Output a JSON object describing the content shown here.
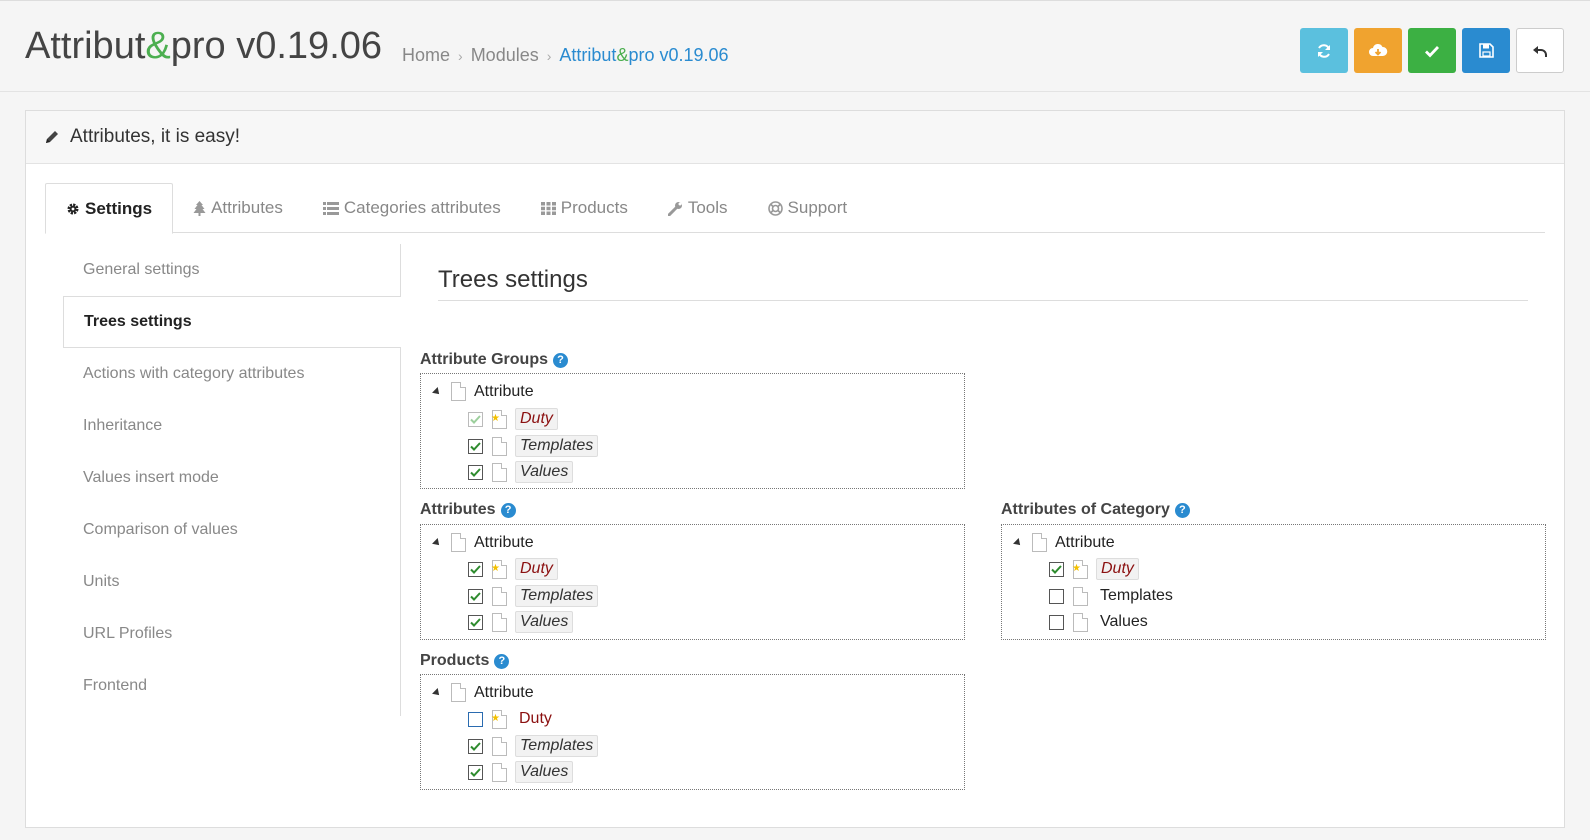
{
  "header": {
    "title_prefix": "Attribut",
    "title_amp": "&",
    "title_suffix": "pro v0.19.06",
    "breadcrumb": {
      "home": "Home",
      "modules": "Modules",
      "current_prefix": "Attribut",
      "current_amp": "&",
      "current_suffix": "pro v0.19.06"
    }
  },
  "toolbar": [
    {
      "icon": "refresh-icon"
    },
    {
      "icon": "cloud-download-icon"
    },
    {
      "icon": "check-icon"
    },
    {
      "icon": "floppy-save-icon"
    },
    {
      "icon": "undo-icon"
    }
  ],
  "panel": {
    "heading": "Attributes, it is easy!"
  },
  "tabs": [
    {
      "label": "Settings",
      "icon": "gear-icon",
      "active": true
    },
    {
      "label": "Attributes",
      "icon": "tree-icon"
    },
    {
      "label": "Categories attributes",
      "icon": "list-icon"
    },
    {
      "label": "Products",
      "icon": "grid-icon"
    },
    {
      "label": "Tools",
      "icon": "wrench-icon"
    },
    {
      "label": "Support",
      "icon": "lifebuoy-icon"
    }
  ],
  "sidenav": [
    {
      "label": "General settings"
    },
    {
      "label": "Trees settings",
      "active": true
    },
    {
      "label": "Actions with category attributes"
    },
    {
      "label": "Inheritance"
    },
    {
      "label": "Values insert mode"
    },
    {
      "label": "Comparison of values"
    },
    {
      "label": "Units"
    },
    {
      "label": "URL Profiles"
    },
    {
      "label": "Frontend"
    }
  ],
  "section_title": "Trees settings",
  "trees": {
    "attribute_groups": {
      "label": "Attribute Groups",
      "root": "Attribute",
      "items": [
        {
          "label": "Duty",
          "checked": true,
          "disabled": true
        },
        {
          "label": "Templates",
          "checked": true
        },
        {
          "label": "Values",
          "checked": true
        }
      ]
    },
    "attributes": {
      "label": "Attributes",
      "root": "Attribute",
      "items": [
        {
          "label": "Duty",
          "checked": true
        },
        {
          "label": "Templates",
          "checked": true
        },
        {
          "label": "Values",
          "checked": true
        }
      ]
    },
    "attributes_of_category": {
      "label": "Attributes of Category",
      "root": "Attribute",
      "items": [
        {
          "label": "Duty",
          "checked": true
        },
        {
          "label": "Templates",
          "checked": false
        },
        {
          "label": "Values",
          "checked": false
        }
      ]
    },
    "products": {
      "label": "Products",
      "root": "Attribute",
      "items": [
        {
          "label": "Duty",
          "checked": false
        },
        {
          "label": "Templates",
          "checked": true
        },
        {
          "label": "Values",
          "checked": true
        }
      ]
    }
  },
  "colors": {
    "accent_green": "#4caf50",
    "link_blue": "#2a8bd0",
    "duty_red": "#8b1010"
  }
}
